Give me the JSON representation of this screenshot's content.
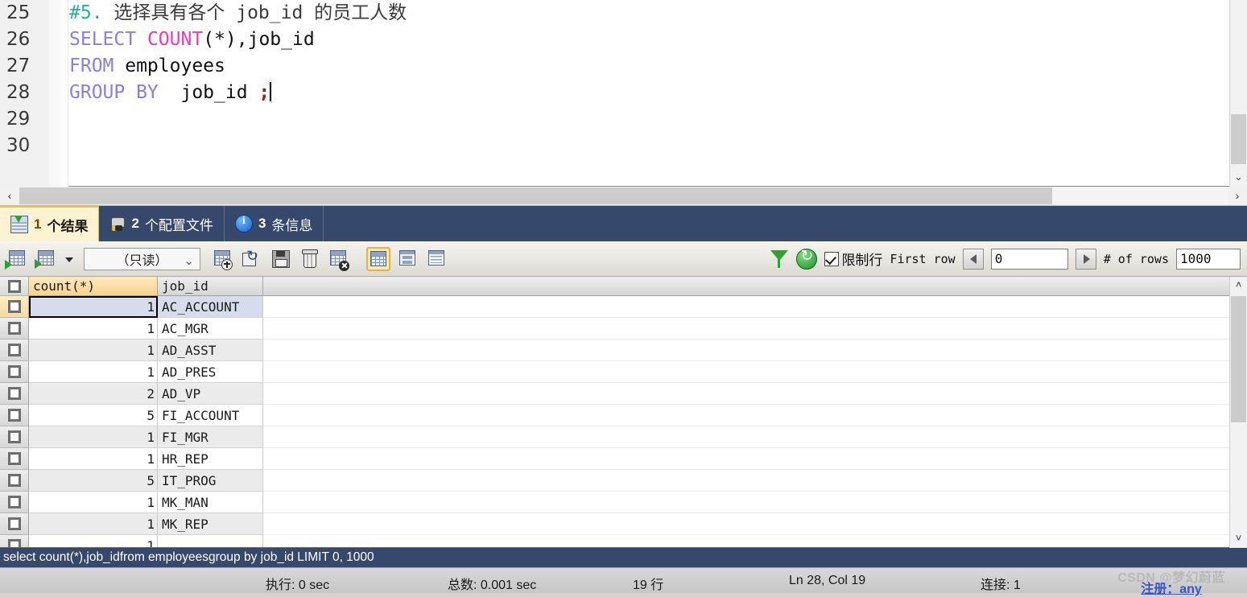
{
  "editor": {
    "lines": [
      {
        "no": "25",
        "kind": "comment",
        "hash": "#5.",
        "text": " 选择具有各个 job_id 的员工人数"
      },
      {
        "no": "26",
        "kind": "sql",
        "kw1": "SELECT",
        "fn": "COUNT",
        "rest": "(*),job_id"
      },
      {
        "no": "27",
        "kind": "sql2",
        "kw1": "FROM",
        "rest": " employees"
      },
      {
        "no": "28",
        "kind": "sql3",
        "kw1": "GROUP BY",
        "rest": "  job_id ",
        "semi": ";"
      },
      {
        "no": "29",
        "kind": "blank",
        "text": ""
      },
      {
        "no": "30",
        "kind": "blank",
        "text": ""
      }
    ],
    "scroll_left_arrow": "‹",
    "scroll_right_arrow": "›",
    "scroll_down_arrow": "⌄"
  },
  "tabs": [
    {
      "label": "1 个结果",
      "num": "1",
      "rest": " 个结果",
      "icon": "results-grid-icon",
      "active": true
    },
    {
      "label": "2 个配置文件",
      "num": "2",
      "rest": " 个配置文件",
      "icon": "profile-icon",
      "active": false
    },
    {
      "label": "3 条信息",
      "num": "3",
      "rest": " 条信息",
      "icon": "info-icon",
      "active": false
    }
  ],
  "toolbar": {
    "editmode_value": "（只读）",
    "chevron": "⌄",
    "limit_label": "限制行",
    "first_row_label": "First row",
    "first_row_value": "0",
    "num_rows_label": "# of rows",
    "num_rows_value": "1000",
    "icons": {
      "export": "export-recordset-icon",
      "import": "import-recordset-icon",
      "import_caret": "chevron-down-icon",
      "insert_row": "insert-row-icon",
      "revert": "revert-icon",
      "apply": "save-icon",
      "delete_row": "delete-row-icon",
      "clear_filter": "clear-row-icon",
      "view_grid": "grid-view-icon",
      "view_form": "form-view-icon",
      "view_text": "text-view-icon",
      "filter": "filter-icon",
      "refresh": "refresh-icon"
    }
  },
  "grid": {
    "columns": [
      "count(*)",
      "job_id"
    ],
    "rows": [
      {
        "count": "1",
        "job_id": "AC_ACCOUNT"
      },
      {
        "count": "1",
        "job_id": "AC_MGR"
      },
      {
        "count": "1",
        "job_id": "AD_ASST"
      },
      {
        "count": "1",
        "job_id": "AD_PRES"
      },
      {
        "count": "2",
        "job_id": "AD_VP"
      },
      {
        "count": "5",
        "job_id": "FI_ACCOUNT"
      },
      {
        "count": "1",
        "job_id": "FI_MGR"
      },
      {
        "count": "1",
        "job_id": "HR_REP"
      },
      {
        "count": "5",
        "job_id": "IT_PROG"
      },
      {
        "count": "1",
        "job_id": "MK_MAN"
      },
      {
        "count": "1",
        "job_id": "MK_REP"
      },
      {
        "count": "1",
        "job_id": ""
      }
    ],
    "scroll_up_arrow": "˄",
    "scroll_down_arrow": "˅"
  },
  "query_line": "select count(*),job_idfrom employeesgroup by  job_id  LIMIT 0, 1000",
  "status": {
    "exec": "执行: 0 sec",
    "total": "总数: 0.001 sec",
    "rows": "19 行",
    "cursor": "Ln 28, Col 19",
    "connection": "连接: 1"
  },
  "watermark": {
    "line1": "CSDN @梦幻蔚蓝",
    "line2": "注册：any"
  },
  "colors": {
    "tabbar_bg": "#36486b",
    "active_tab_bg": "#fdf3d2",
    "keyword": "#8a7fe0",
    "function": "#f03cb0",
    "comment": "#23b0a0",
    "header_active": "#f8d48d"
  }
}
